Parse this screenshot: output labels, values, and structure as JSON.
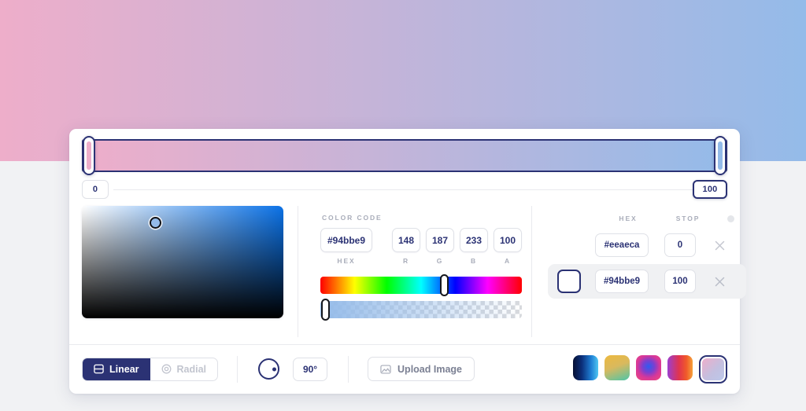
{
  "backdrop": {
    "gradient_css": "linear-gradient(90deg, #eeaeca 0%, #94bbe9 100%)",
    "lower_bg": "#f1f2f4"
  },
  "gradient_bar": {
    "css": "linear-gradient(90deg, #eeaeca 0%, #94bbe9 100%)",
    "handles": [
      {
        "name": "stop-handle-start",
        "position_label": "0",
        "color": "#eeaeca",
        "selected": false
      },
      {
        "name": "stop-handle-end",
        "position_label": "100",
        "color": "#94bbe9",
        "selected": true
      }
    ]
  },
  "color_code": {
    "section_label": "COLOR CODE",
    "hex_value": "#94bbe9",
    "hex_caption": "HEX",
    "channels": [
      {
        "caption": "R",
        "value": "148"
      },
      {
        "caption": "G",
        "value": "187"
      },
      {
        "caption": "B",
        "value": "233"
      },
      {
        "caption": "A",
        "value": "100"
      }
    ]
  },
  "picker": {
    "base_hue_color": "#0b72e7",
    "cursor_color": "#94bbe9",
    "hue_knob_percent": 60,
    "alpha_knob_percent": 0,
    "alpha_color": "#94bbe9"
  },
  "stops_panel": {
    "headers": {
      "hex": "HEX",
      "stop": "STOP",
      "actions_icon": "dot-icon"
    },
    "rows": [
      {
        "color": "#eeaeca",
        "hex": "#eeaeca",
        "stop": "0",
        "selected": false,
        "delete_icon": "close-icon"
      },
      {
        "color": "#94bbe9",
        "hex": "#94bbe9",
        "stop": "100",
        "selected": true,
        "delete_icon": "close-icon"
      }
    ]
  },
  "footer": {
    "mode": {
      "linear_label": "Linear",
      "radial_label": "Radial",
      "active": "Linear"
    },
    "angle": {
      "value": "90°",
      "degrees": 90
    },
    "upload": {
      "label": "Upload Image",
      "icon": "image-icon"
    },
    "presets": [
      {
        "name": "preset-blue-cyan",
        "css": "linear-gradient(90deg, #061033 0%, #0b2f7a 35%, #1f7fd4 72%, #4fc6f2 100%)",
        "selected": false
      },
      {
        "name": "preset-yellow-teal",
        "css": "linear-gradient(160deg, #edb93f 0%, #d9b95e 45%, #4ec5a8 100%)",
        "selected": false
      },
      {
        "name": "preset-pink-blue-radial",
        "css": "radial-gradient(circle at 50% 45%, #2f5cf0 0%, #7b3fd0 32%, #d6379a 60%, #ef4b7b 100%)",
        "selected": false
      },
      {
        "name": "preset-purple-red-orange",
        "css": "linear-gradient(90deg, #9b3fd1 0%, #e0344f 45%, #f05a2a 75%, #f5a13a 100%)",
        "selected": false
      },
      {
        "name": "preset-pink-blue-current",
        "css": "linear-gradient(135deg, #eeaeca 0%, #c4bfdf 55%, #bcc8ea 100%)",
        "selected": true
      }
    ]
  }
}
